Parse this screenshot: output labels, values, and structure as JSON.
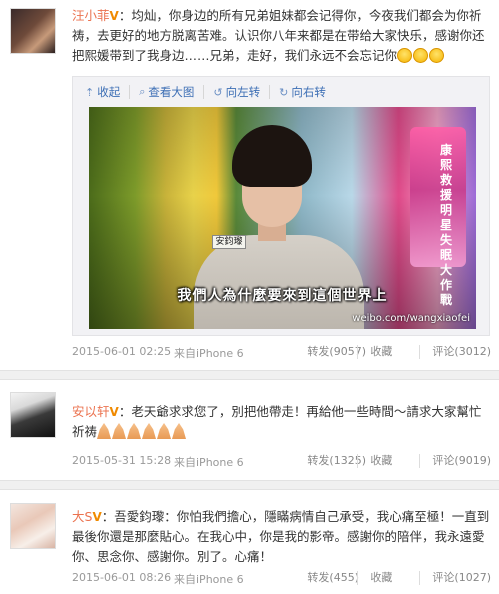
{
  "posts": [
    {
      "username": "汪小菲",
      "verified_badge": "V",
      "text": "：均灿，你身边的所有兄弟姐妹都会记得你，今夜我们都会为你祈祷，去更好的地方脱离苦难。认识你八年来都是在带给大家快乐，感谢你还把熙媛带到了我身边……兄弟，走好，我们永远不会忘记你",
      "emoji_icon": "crying-face-icon",
      "media_toolbar": {
        "collapse": "收起",
        "view_large": "查看大图",
        "rotate_left": "向左转",
        "rotate_right": "向右转"
      },
      "photo": {
        "subtitle": "我們人為什麼要來到這個世界上",
        "name_tag": "安鈞瓈",
        "show_logo": "康熙救援明星失眠大作戰",
        "watermark": "weibo.com/wangxiaofei"
      },
      "time": "2015-06-01 02:25",
      "source": "来自iPhone 6",
      "repost": "转发(9057)",
      "favorite": "收藏",
      "comment": "评论(3012)"
    },
    {
      "username": "安以轩",
      "verified_badge": "V",
      "text_line1": "：老天爺求求您了，別把他帶走！再給他一些時間～請求大家幫忙",
      "text_line2": "祈祷",
      "emoji_icon": "praying-hands-icon",
      "time": "2015-05-31 15:28",
      "source": "来自iPhone 6",
      "repost": "转发(1325)",
      "favorite": "收藏",
      "comment": "评论(9019)"
    },
    {
      "username": "大S",
      "verified_badge": "V",
      "text": "：吾愛鈞瓈：你怕我們擔心，隱瞞病情自己承受，我心痛至極！一直到最後你還是那麼貼心。在我心中，你是我的影帝。感謝你的陪伴，我永遠愛你、思念你、感謝你。別了。心痛！",
      "time": "2015-06-01 08:26",
      "source": "来自iPhone 6",
      "repost": "转发(455)",
      "favorite": "收藏",
      "comment": "评论(1027)"
    }
  ],
  "colors": {
    "username": "#eb7350",
    "link": "#3d6fb5",
    "meta": "#999999",
    "separator": "#f0f0f0"
  }
}
